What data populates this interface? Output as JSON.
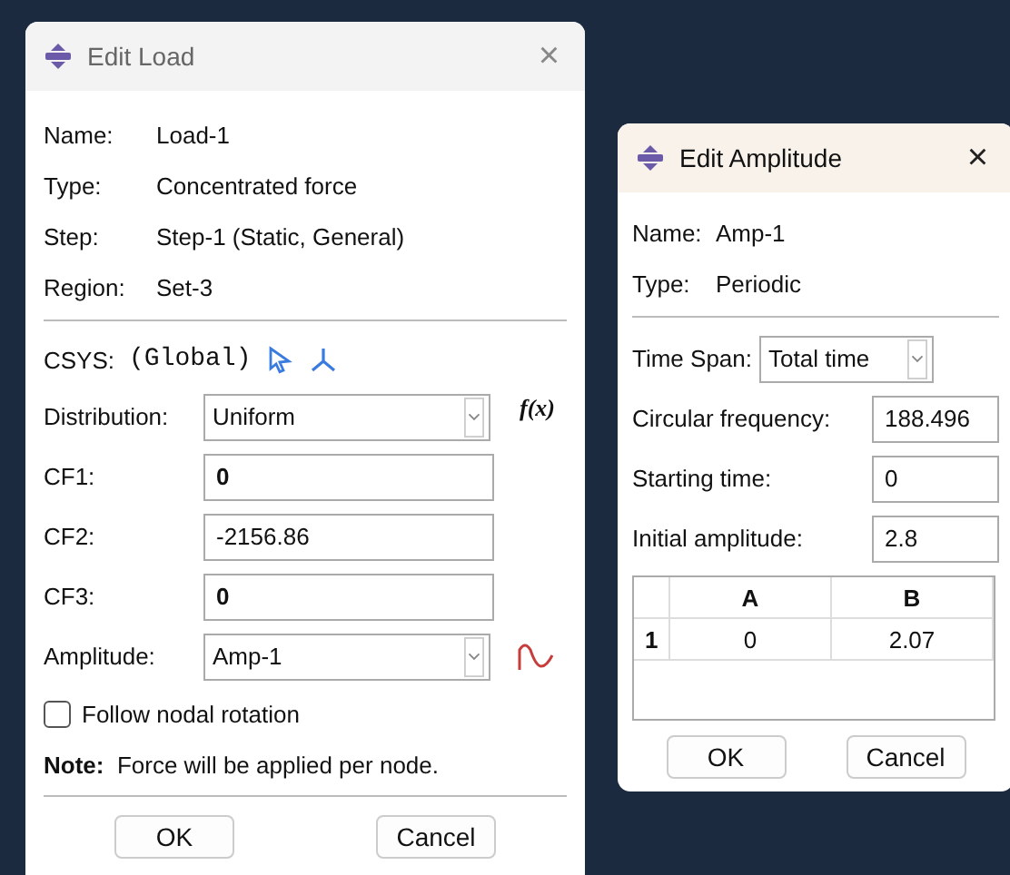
{
  "edit_load": {
    "title": "Edit Load",
    "close": "×",
    "info": [
      {
        "label": "Name:",
        "value": "Load-1"
      },
      {
        "label": "Type:",
        "value": "Concentrated force"
      },
      {
        "label": "Step:",
        "value": "Step-1 (Static, General)"
      },
      {
        "label": "Region:",
        "value": "Set-3"
      }
    ],
    "csys": {
      "label": "CSYS:",
      "value": "(Global)"
    },
    "distribution": {
      "label": "Distribution:",
      "value": "Uniform",
      "fx": "f(x)"
    },
    "components": [
      {
        "label": "CF1:",
        "value": "0",
        "bold": true
      },
      {
        "label": "CF2:",
        "value": "-2156.86",
        "bold": false
      },
      {
        "label": "CF3:",
        "value": "0",
        "bold": true
      }
    ],
    "amplitude": {
      "label": "Amplitude:",
      "value": "Amp-1"
    },
    "follow_nodal_rotation": {
      "label": "Follow nodal rotation",
      "checked": false
    },
    "note": "**Note:**  Force will be applied per node.",
    "buttons": [
      "OK",
      "Cancel"
    ]
  },
  "edit_amplitude": {
    "title": "Edit Amplitude",
    "close": "×",
    "info": [
      {
        "label": "Name:",
        "value": "Amp-1"
      },
      {
        "label": "Type:",
        "value": "Periodic"
      }
    ],
    "time_span": {
      "label": "Time Span:",
      "value": "Total time"
    },
    "fields": [
      {
        "label": "Circular frequency:",
        "value": "188.496"
      },
      {
        "label": "Starting time:",
        "value": "0"
      },
      {
        "label": "Initial amplitude:",
        "value": "2.8"
      }
    ],
    "table": {
      "columns": [
        "A",
        "B"
      ],
      "rows": [
        {
          "index": "1",
          "cells": [
            "0",
            "2.07"
          ]
        }
      ]
    },
    "buttons": [
      "OK",
      "Cancel"
    ]
  }
}
